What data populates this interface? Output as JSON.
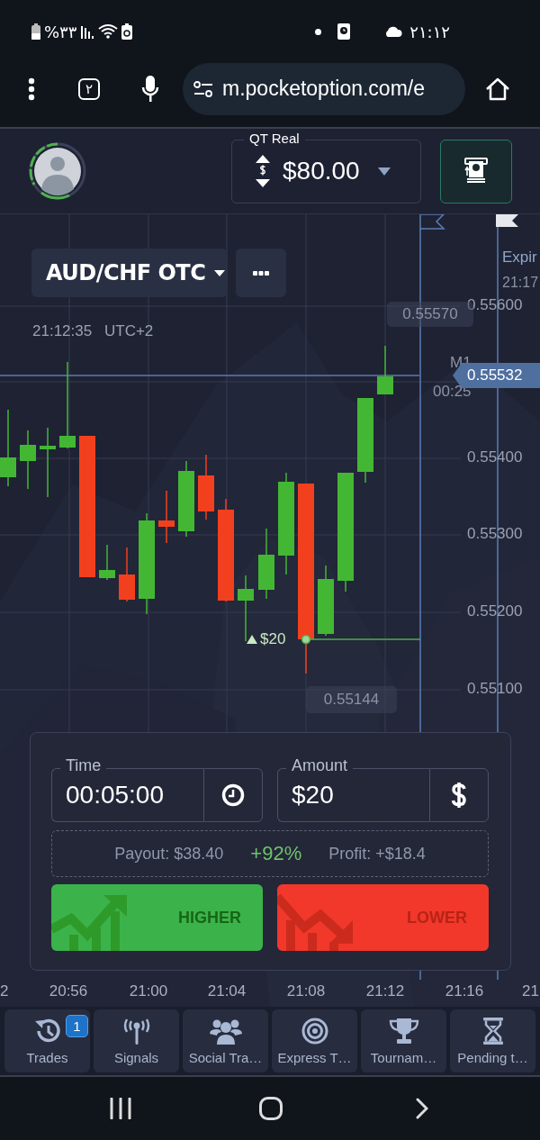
{
  "status_bar": {
    "battery_percent": "%۳۳",
    "time": "۲۱:۱۲"
  },
  "browser": {
    "tab_count": "۲",
    "url": "m.pocketoption.com/e"
  },
  "header": {
    "account_label": "QT Real",
    "balance": "$80.00"
  },
  "chart": {
    "asset": "AUD/CHF OTC",
    "clock": "21:12:35",
    "timezone": "UTC+2",
    "expiration_label": "Expir",
    "expiration_time": "21:17",
    "high_label": "0.55570",
    "low_label": "0.55144",
    "y_labels": [
      "0.55600",
      "0.55400",
      "0.55300",
      "0.55200",
      "0.55100"
    ],
    "timeframe": "M1",
    "countdown": "00:25",
    "current_price": "0.55532",
    "trade_marker": "$20",
    "x_labels": [
      "2",
      "20:56",
      "21:00",
      "21:04",
      "21:08",
      "21:12",
      "21:16",
      "21"
    ]
  },
  "trade_panel": {
    "time": {
      "label": "Time",
      "value": "00:05:00"
    },
    "amount": {
      "label": "Amount",
      "value": "$20"
    },
    "payout": "Payout: $38.40",
    "percent": "+92%",
    "profit": "Profit: +$18.4",
    "buttons": [
      {
        "kind": "higher",
        "label": "HIGHER"
      },
      {
        "kind": "lower",
        "label": "LOWER"
      }
    ]
  },
  "bottom_nav": [
    {
      "kind": "trades",
      "label": "Trades",
      "badge": "1"
    },
    {
      "kind": "signals",
      "label": "Signals"
    },
    {
      "kind": "social",
      "label": "Social Tra…"
    },
    {
      "kind": "express",
      "label": "Express T…"
    },
    {
      "kind": "tournaments",
      "label": "Tournam…"
    },
    {
      "kind": "pending",
      "label": "Pending t…"
    }
  ]
}
